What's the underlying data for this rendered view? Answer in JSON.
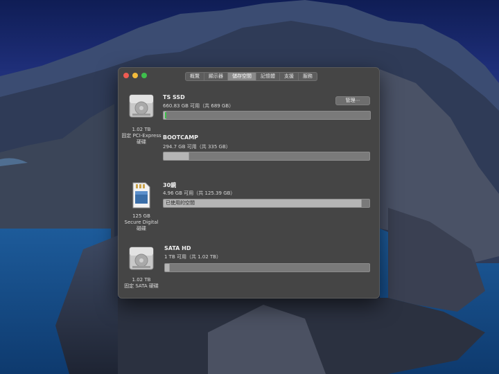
{
  "window": {
    "tabs": [
      {
        "label": "概覽",
        "active": false
      },
      {
        "label": "顯示器",
        "active": false
      },
      {
        "label": "儲存空間",
        "active": true
      },
      {
        "label": "記憶體",
        "active": false
      },
      {
        "label": "支援",
        "active": false
      },
      {
        "label": "服務",
        "active": false
      }
    ],
    "manage_button": "管理⋯"
  },
  "drives": [
    {
      "icon": "hdd-icon",
      "caption": [
        "1.02 TB",
        "固定 PCI-Express",
        "硬碟"
      ],
      "volumes": [
        {
          "name": "TS SSD",
          "info": "660.83 GB 可用（共 689 GB）",
          "used_fraction": 0.01,
          "indicator_color": "#3ec04a"
        },
        {
          "name": "BOOTCAMP",
          "info": "294.7 GB 可用（共 335 GB）",
          "used_fraction": 0.12
        }
      ]
    },
    {
      "icon": "sd-card-icon",
      "caption": [
        "125 GB",
        "Secure Digital",
        "磁碟"
      ],
      "volumes": [
        {
          "name": "30鏡",
          "info": "4.96 GB 可用（共 125.39 GB）",
          "used_fraction": 0.96,
          "bar_label": "已使用的空間"
        }
      ]
    },
    {
      "icon": "hdd-icon",
      "caption": [
        "1.02 TB",
        "固定 SATA 硬碟"
      ],
      "volumes": [
        {
          "name": "SATA HD",
          "info": "1 TB 可用（共 1.02 TB）",
          "used_fraction": 0.02
        }
      ]
    }
  ],
  "colors": {
    "window_bg": "#454545",
    "bar_bg": "#7a7a7a",
    "bar_used": "#b5b5b5",
    "ssd_indicator": "#3ec04a"
  }
}
